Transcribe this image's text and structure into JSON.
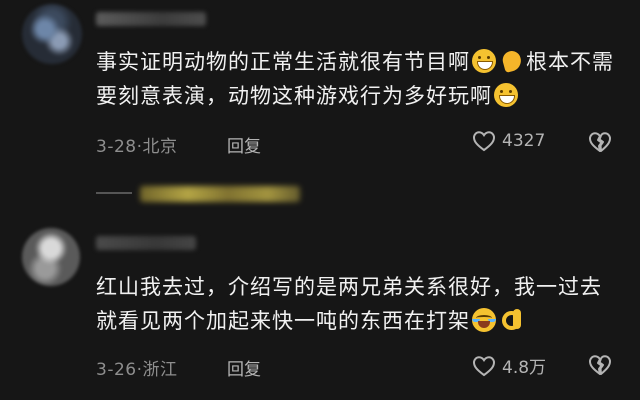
{
  "comments": [
    {
      "text_parts": [
        "事实证明动物的正常生活就很有节目啊",
        "根本不需要刻意表演，动物这种游戏行为多好玩啊"
      ],
      "emojis": [
        "grin",
        "flex",
        "grin"
      ],
      "date": "3-28",
      "separator": "·",
      "location": "北京",
      "reply_label": "回复",
      "like_count": "4327"
    },
    {
      "text_parts": [
        "红山我去过，介绍写的是两兄弟关系很好，我一过去就看见两个加起来快一吨的东西在打架"
      ],
      "emojis": [
        "laugh-cry",
        "ok"
      ],
      "date": "3-26",
      "separator": "·",
      "location": "浙江",
      "reply_label": "回复",
      "like_count": "4.8万"
    }
  ],
  "colors": {
    "background": "#161616",
    "text": "#f1f1f1",
    "meta": "#8e8e8e",
    "icon": "#b4b4b4"
  },
  "icons": [
    "heart-outline-icon",
    "broken-heart-icon",
    "grinning-emoji",
    "flexed-biceps-emoji",
    "laugh-crying-emoji",
    "ok-hand-emoji"
  ]
}
